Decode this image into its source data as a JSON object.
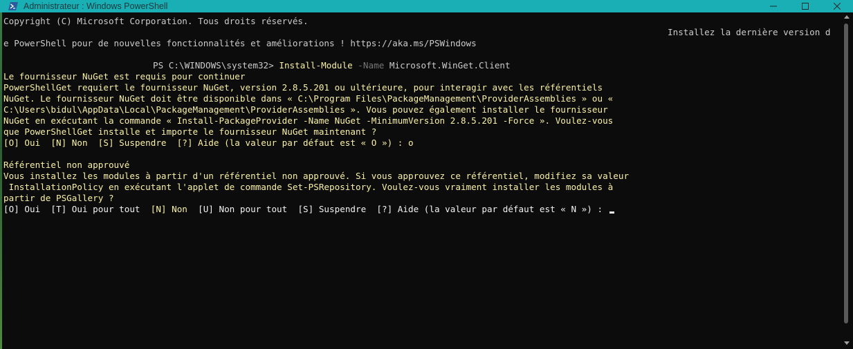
{
  "titlebar": {
    "title": "Administrateur : Windows PowerShell",
    "icon": "powershell-icon",
    "color": "#1aaeb5",
    "minimize_icon": "minimize-icon",
    "maximize_icon": "maximize-icon",
    "close_icon": "close-icon"
  },
  "console": {
    "background": "#0c0c0c",
    "lines": {
      "l0": "Copyright (C) Microsoft Corporation. Tous droits réservés.",
      "l1": "Installez la dernière version d",
      "l2": "e PowerShell pour de nouvelles fonctionnalités et améliorations ! https://aka.ms/PSWindows",
      "l3": "Le fournisseur NuGet est requis pour continuer",
      "l4": "PowerShellGet requiert le fournisseur NuGet, version 2.8.5.201 ou ultérieure, pour interagir avec les référentiels",
      "l5": "NuGet. Le fournisseur NuGet doit être disponible dans « C:\\Program Files\\PackageManagement\\ProviderAssemblies » ou «",
      "l6": "C:\\Users\\bidul\\AppData\\Local\\PackageManagement\\ProviderAssemblies ». Vous pouvez également installer le fournisseur",
      "l7": "NuGet en exécutant la commande « Install-PackageProvider -Name NuGet -MinimumVersion 2.8.5.201 -Force ». Voulez-vous",
      "l8": "que PowerShellGet installe et importe le fournisseur NuGet maintenant ?",
      "l9": "[O] Oui  [N] Non  [S] Suspendre  [?] Aide (la valeur par défaut est « O ») : o",
      "l10": "Référentiel non approuvé",
      "l11": "Vous installez les modules à partir d'un référentiel non approuvé. Si vous approuvez ce référentiel, modifiez sa valeur",
      "l12": " InstallationPolicy en exécutant l'applet de commande Set-PSRepository. Voulez-vous vraiment installer les modules à",
      "l13": "partir de PSGallery ?"
    },
    "prompt": {
      "path": "PS C:\\WINDOWS\\system32> ",
      "command": "Install-Module",
      "param": " -Name",
      "arg": " Microsoft.WinGet.Client"
    },
    "choice": {
      "a": "[O] Oui  [T] Oui pour tout  ",
      "b": "[N] Non",
      "c": "  [U] Non pour tout  [S] Suspendre  [?] Aide (la valeur par défaut est « N ») : "
    },
    "colors": {
      "text": "#cccccc",
      "command": "#f9f1a5",
      "parameter": "#767676"
    }
  }
}
